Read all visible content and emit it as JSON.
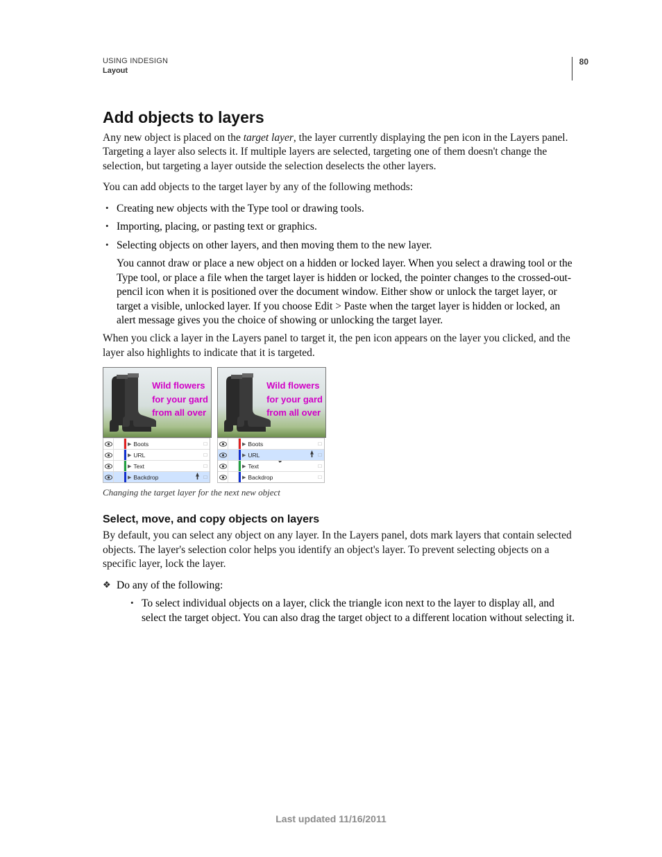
{
  "header": {
    "running": "USING INDESIGN",
    "section_running": "Layout",
    "page_number": "80"
  },
  "h2": "Add objects to layers",
  "p1_a": "Any new object is placed on the ",
  "p1_em": "target layer",
  "p1_b": ", the layer currently displaying the pen icon in the Layers panel. Targeting a layer also selects it. If multiple layers are selected, targeting one of them doesn't change the selection, but targeting a layer outside the selection deselects the other layers.",
  "p2": "You can add objects to the target layer by any of the following methods:",
  "bullets": {
    "b1": "Creating new objects with the Type tool or drawing tools.",
    "b2": "Importing, placing, or pasting text or graphics.",
    "b3": "Selecting objects on other layers, and then moving them to the new layer."
  },
  "note": "You cannot draw or place a new object on a hidden or locked layer. When you select a drawing tool or the Type tool, or place a file when the target layer is hidden or locked, the pointer changes to the crossed-out-pencil icon when it is positioned over the document window. Either show or unlock the target layer, or target a visible, unlocked layer. If you choose Edit > Paste when the target layer is hidden or locked, an alert message gives you the choice of showing or unlocking the target layer.",
  "p3": "When you click a layer in the Layers panel to target it, the pen icon appears on the layer you clicked, and the layer also highlights to indicate that it is targeted.",
  "figure": {
    "overlay_lines": {
      "l1": "Wild flowers",
      "l2": "for your gard",
      "l3": "from all over"
    },
    "layers_left": [
      {
        "name": "Boots",
        "color": "#e02020",
        "selected": false,
        "pen": false
      },
      {
        "name": "URL",
        "color": "#1030d0",
        "selected": false,
        "pen": false
      },
      {
        "name": "Text",
        "color": "#20a040",
        "selected": false,
        "pen": false
      },
      {
        "name": "Backdrop",
        "color": "#1030d0",
        "selected": true,
        "pen": true
      }
    ],
    "layers_right": [
      {
        "name": "Boots",
        "color": "#e02020",
        "selected": false,
        "pen": false
      },
      {
        "name": "URL",
        "color": "#1030d0",
        "selected": true,
        "pen": true
      },
      {
        "name": "Text",
        "color": "#20a040",
        "selected": false,
        "pen": false
      },
      {
        "name": "Backdrop",
        "color": "#1030d0",
        "selected": false,
        "pen": false
      }
    ],
    "caption": "Changing the target layer for the next new object"
  },
  "h3": "Select, move, and copy objects on layers",
  "p4": "By default, you can select any object on any layer. In the Layers panel, dots mark layers that contain selected objects. The layer's selection color helps you identify an object's layer. To prevent selecting objects on a specific layer, lock the layer.",
  "diamond": {
    "d1": "Do any of the following:"
  },
  "nested": {
    "n1": "To select individual objects on a layer, click the triangle icon next to the layer to display all, and select the target object. You can also drag the target object to a different location without selecting it."
  },
  "footer": "Last updated 11/16/2011"
}
